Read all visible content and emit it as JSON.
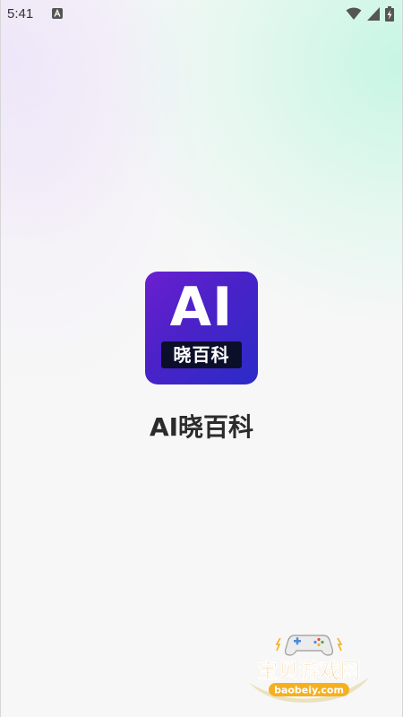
{
  "status_bar": {
    "time": "5:41",
    "icons": [
      "notification-a-icon",
      "wifi-icon",
      "signal-icon",
      "battery-charging-icon"
    ]
  },
  "splash": {
    "logo_main": "AI",
    "logo_sub": "晓百科",
    "app_name": "AI晓百科",
    "logo_gradient": [
      "#6a1fd0",
      "#2a2cc8"
    ]
  },
  "watermark": {
    "title": "宝贝游戏网",
    "url": "baobeiy.com",
    "colors": {
      "title": "#f0a020",
      "url_bg": "#f5b020"
    }
  }
}
